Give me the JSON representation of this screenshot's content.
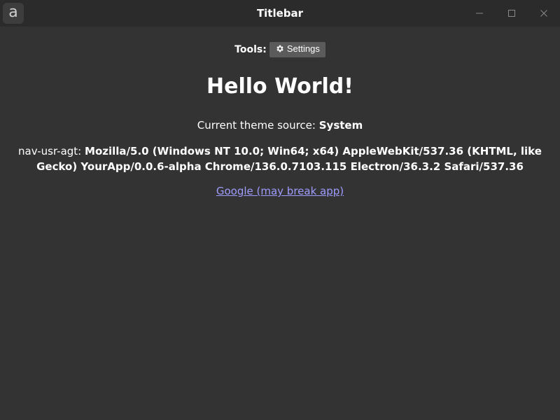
{
  "window": {
    "title": "Titlebar",
    "app_icon_letter": "a",
    "background_color": "#333333",
    "titlebar_color": "#2b2b2b"
  },
  "toolbar": {
    "tools_label": "Tools:",
    "settings_label": "Settings",
    "settings_icon": "gear-icon"
  },
  "main": {
    "heading": "Hello World!",
    "theme_prefix": "Current theme source:",
    "theme_value": "System",
    "ua_prefix": "nav-usr-agt:",
    "ua_value": "Mozilla/5.0 (Windows NT 10.0; Win64; x64) AppleWebKit/537.36 (KHTML, like Gecko) YourApp/0.0.6-alpha Chrome/136.0.7103.115 Electron/36.3.2 Safari/537.36",
    "link_text": "Google (may break app)",
    "link_color": "#9f9cff"
  }
}
